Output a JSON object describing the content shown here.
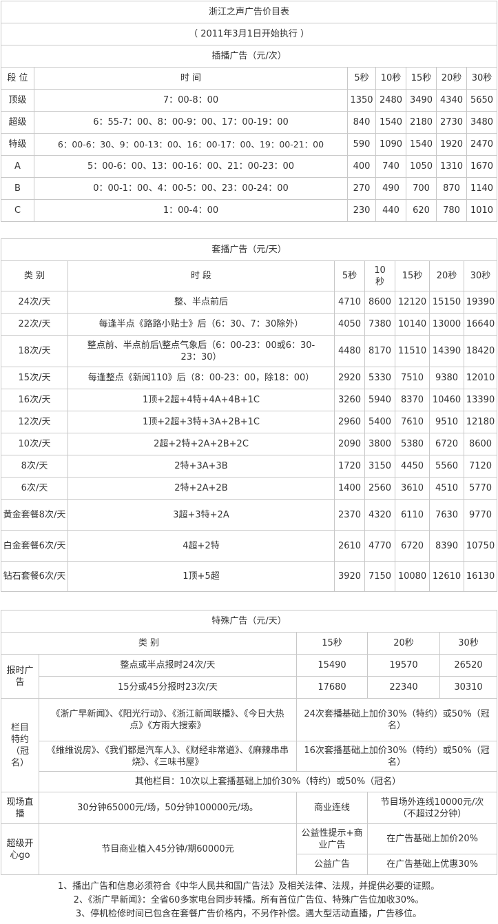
{
  "t1": {
    "title": "浙江之声广告价目表",
    "subtitle": "（ 2011年3月1日开始执行 ）",
    "section": "插播广告（元/次）",
    "headers": [
      "段 位",
      "时 间",
      "5秒",
      "10秒",
      "15秒",
      "20秒",
      "30秒"
    ],
    "rows": [
      {
        "grade": "顶级",
        "time": "7：00-8：00",
        "prices": [
          "1350",
          "2480",
          "3490",
          "4340",
          "5650"
        ]
      },
      {
        "grade": "超级",
        "time": "6：55-7：00、8：00-9：00、17：00-19：00",
        "prices": [
          "840",
          "1540",
          "2180",
          "2730",
          "3480"
        ]
      },
      {
        "grade": "特级",
        "time": "6：00-6：30、9：00-13：00、16：00-17：00、19：00-21：00",
        "prices": [
          "590",
          "1090",
          "1540",
          "1920",
          "2470"
        ]
      },
      {
        "grade": "A",
        "time": "5：00-6：00、13：00-16：00、21：00-23：00",
        "prices": [
          "400",
          "740",
          "1050",
          "1310",
          "1670"
        ]
      },
      {
        "grade": "B",
        "time": "0：00-1：00、4：00-5：00、23：00-24：00",
        "prices": [
          "270",
          "490",
          "700",
          "870",
          "1140"
        ]
      },
      {
        "grade": "C",
        "time": "1：00-4：00",
        "prices": [
          "230",
          "440",
          "620",
          "780",
          "1010"
        ]
      }
    ]
  },
  "t2": {
    "section": "套播广告（元/天）",
    "headers": [
      "类 别",
      "时 段",
      "5秒",
      "10秒",
      "15秒",
      "20秒",
      "30秒"
    ],
    "rows": [
      {
        "type": "24次/天",
        "period": "整、半点前后",
        "prices": [
          "4710",
          "8600",
          "12120",
          "15150",
          "19390"
        ]
      },
      {
        "type": "22次/天",
        "period": "每逢半点《路路小贴士》后（6：30、7：30除外）",
        "prices": [
          "4050",
          "7380",
          "10140",
          "13000",
          "16640"
        ]
      },
      {
        "type": "18次/天",
        "period": "整点前、半点前后\\整点气象后（6：00-23：00或6：30-23：30）",
        "prices": [
          "4480",
          "8170",
          "11510",
          "14390",
          "18420"
        ]
      },
      {
        "type": "15次/天",
        "period": "每逢整点《新闻110》后（8：00-23：00，除18：00）",
        "prices": [
          "2920",
          "5330",
          "7510",
          "9380",
          "12010"
        ]
      },
      {
        "type": "16次/天",
        "period": "1顶+2超+4特+4A+4B+1C",
        "prices": [
          "3260",
          "5940",
          "8370",
          "10460",
          "13390"
        ]
      },
      {
        "type": "12次/天",
        "period": "1顶+2超+3特+3A+2B+1C",
        "prices": [
          "2960",
          "5400",
          "7610",
          "9510",
          "12180"
        ]
      },
      {
        "type": "10次/天",
        "period": "2超+2特+2A+2B+2C",
        "prices": [
          "2090",
          "3800",
          "5380",
          "6720",
          "8600"
        ]
      },
      {
        "type": "8次/天",
        "period": "2特+3A+3B",
        "prices": [
          "1720",
          "3150",
          "4450",
          "5560",
          "7120"
        ]
      },
      {
        "type": "6次/天",
        "period": "2特+2A+2B",
        "prices": [
          "1400",
          "2560",
          "3610",
          "4510",
          "5770"
        ]
      },
      {
        "type": "黄金套餐8次/天",
        "period": "3超+3特+2A",
        "prices": [
          "2370",
          "4320",
          "6110",
          "7630",
          "9770"
        ]
      },
      {
        "type": "白金套餐6次/天",
        "period": "4超+2特",
        "prices": [
          "2610",
          "4770",
          "6720",
          "8390",
          "10750"
        ]
      },
      {
        "type": "钻石套餐6次/天",
        "period": "1顶+5超",
        "prices": [
          "3920",
          "7150",
          "10080",
          "12610",
          "16130"
        ]
      }
    ]
  },
  "t3": {
    "section": "特殊广告（元/天）",
    "headers": [
      "类 别",
      "15秒",
      "20秒",
      "30秒"
    ],
    "time_report_label": "报时广告",
    "time_report_rows": [
      {
        "desc": "整点或半点报时24次/天",
        "prices": [
          "15490",
          "19570",
          "26520"
        ]
      },
      {
        "desc": "15分或45分报时23次/天",
        "prices": [
          "17680",
          "22340",
          "30310"
        ]
      }
    ],
    "column_label": "栏目特约（冠名）",
    "column_rows": [
      {
        "programs": "《浙广早新闻》、《阳光行动》、《浙江新闻联播》、《今日大热点》《方雨大搜索》",
        "price": "24次套播基础上加价30%（特约）或50%（冠名）"
      },
      {
        "programs": "《维维说房》、《我们都是汽车人》、《财经非常道》、《麻辣串串烧》、《三味书屋》",
        "price": "16次套播基础上加价30%（特约）或50%（冠名）"
      }
    ],
    "column_other": "其他栏目：10次以上套播基础上加价30%（特约）或50%（冠名）",
    "live_label": "现场直播",
    "live_desc": "30分钟65000元/场，50分钟100000元/场。",
    "business_link_label": "商业连线",
    "business_link_price": "节目场外连线10000元/次（不超过2分钟）",
    "happy_label": "超级开心go",
    "happy_desc": "节目商业植入45分钟/期60000元",
    "public_biz_label": "公益性提示+商业广告",
    "public_biz_price": "在广告基础上加价20%",
    "public_label": "公益广告",
    "public_price": "在广告基础上优惠30%"
  },
  "notes": [
    "1、播出广告和信息必须符合《中华人民共和国广告法》及相关法律、法规，并提供必要的证照。",
    "2、《浙广早新闻》：全省60多家电台同步转播。所有首位广告位、特殊广告位加收30%。",
    "3、停机检修时间已包含在套餐广告价格内，不另作补偿。遇大型活动直播，广告移位。"
  ]
}
